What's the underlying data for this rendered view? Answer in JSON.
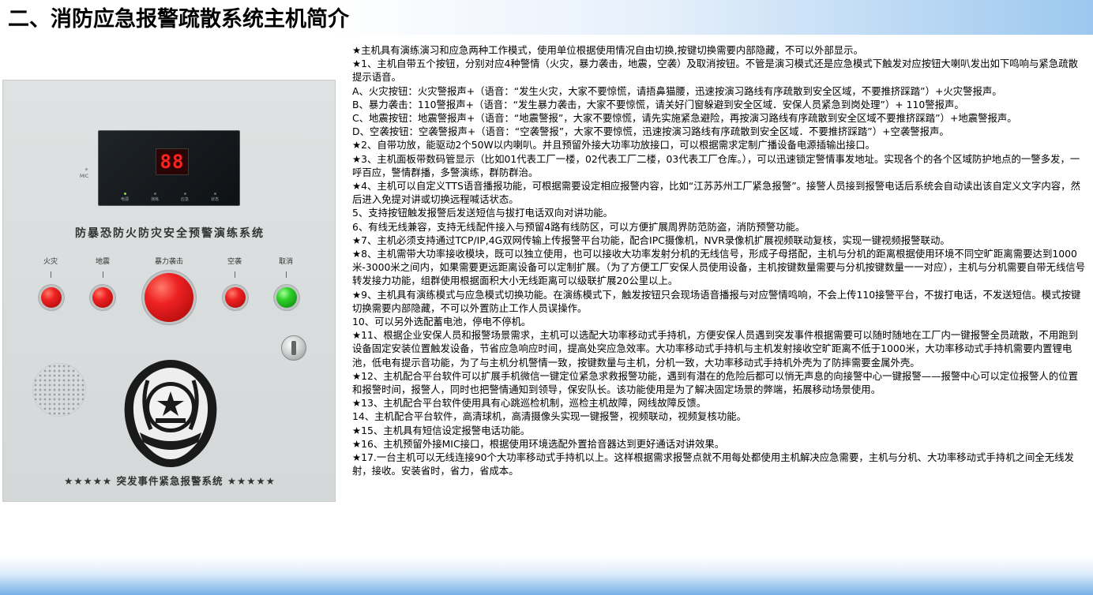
{
  "title": "二、消防应急报警疏散系统主机简介",
  "device": {
    "display_digits": "88",
    "mic_label": "MIC",
    "indicators": [
      "电源",
      "演练",
      "应急",
      "状态"
    ],
    "panel_title": "防暴恐防火防灾安全预警演练系统",
    "buttons": [
      {
        "label": "火灾",
        "color": "red"
      },
      {
        "label": "地震",
        "color": "red"
      },
      {
        "label": "暴力袭击",
        "color": "red"
      },
      {
        "label": "空袭",
        "color": "red"
      },
      {
        "label": "取消",
        "color": "green"
      }
    ],
    "footer": "★★★★★  突发事件紧急报警系统  ★★★★★"
  },
  "paragraphs": [
    "★主机具有演练演习和应急两种工作模式，使用单位根据使用情况自由切换,按键切换需要内部隐藏，不可以外部显示。",
    "★1、主机自带五个按钮，分别对应4种警情（火灾，暴力袭击，地震，空袭）及取消按钮。不管是演习模式还是应急模式下触发对应按钮大喇叭发出如下鸣响与紧急疏散提示语音。",
    "A、火灾按钮：火灾警报声+（语音：“发生火灾，大家不要惊慌，请捂鼻猫腰，迅速按演习路线有序疏散到安全区域，不要推挤踩踏”）+火灾警报声。",
    "B、暴力袭击：110警报声+（语音：“发生暴力袭击，大家不要惊慌，请关好门窗躲避到安全区域．安保人员紧急到岗处理”）+ 110警报声。",
    "C、地震按钮：地震警报声+（语音：“地震警报”，大家不要惊慌，请先实施紧急避险，再按演习路线有序疏散到安全区域不要推挤踩踏”）+地震警报声。",
    "D、空袭按钮：空袭警报声+（语音：“空袭警报”，大家不要惊慌，迅速按演习路线有序疏散到安全区域．不要推挤踩踏”）+空袭警报声。",
    "★2、自带功放，能驱动2个50W以内喇叭。并且预留外接大功率功放接口，可以根据需求定制广播设备电源插输出接口。",
    "★3、主机面板带数码管显示（比如01代表工厂一楼，02代表工厂二楼，03代表工厂仓库。），可以迅速锁定警情事发地址。实现各个的各个区域防护地点的一警多发，一呼百应，警情群播，多警演练，群防群治。",
    "★4、主机可以自定义TTS语音播报功能，可根据需要设定相应报警内容，比如“江苏苏州工厂紧急报警”。接警人员接到报警电话后系统会自动读出该自定义文字内容，然后进入免提对讲或切换远程喊话状态。",
    "5、支持按钮触发报警后发送短信与拔打电话双向对讲功能。",
    "6、有线无线兼容，支持无线配件接入与预留4路有线防区，可以方便扩展周界防范防盗，消防预警功能。",
    "★7、主机必须支持通过TCP/IP,4G双网传输上传报警平台功能，配合IPC摄像机，NVR录像机扩展视频联动复核，实现一键视频报警联动。",
    "★8、主机需带大功率接收模块，既可以独立使用，也可以接收大功率发射分机的无线信号，形成子母搭配，主机与分机的距离根据使用环境不同空旷距离需要达到1000米-3000米之间内，如果需要更远距离设备可以定制扩展。（为了方便工厂安保人员使用设备，主机按键数量需要与分机按键数量一一对应），主机与分机需要自带无线信号转发接力功能，组群使用根据面积大小无线距离可以级联扩展20公里以上。",
    "★9、主机具有演练模式与应急模式切换功能。在演练模式下，触发按钮只会现场语音播报与对应警情鸣响，不会上传110接警平台，不拔打电话，不发送短信。模式按键切换需要内部隐藏，不可以外置防止工作人员误操作。",
    "10、可以另外选配蓄电池，停电不停机。",
    "★11、根据企业安保人员和报警场景需求，主机可以选配大功率移动式手持机，方便安保人员遇到突发事件根据需要可以随时随地在工厂内一键报警全员疏散，不用跑到设备固定安装位置触发设备，节省应急响应时间，提高处突应急效率。大功率移动式手持机与主机发射接收空旷距离不低于1000米，大功率移动式手持机需要内置锂电池，低电有提示音功能，为了与主机分机警情一致，按键数量与主机，分机一致，大功率移动式手持机外壳为了防摔需要金属外壳。",
    "★12、主机配合平台软件可以扩展手机微信一键定位紧急求救报警功能，遇到有潜在的危险后都可以悄无声息的向接警中心一键报警——报警中心可以定位报警人的位置和报警时间，报警人，同时也把警情通知到领导，保安队长。该功能使用是为了解决固定场景的弊端，拓展移动场景使用。",
    "★13、主机配合平台软件使用具有心跳巡检机制，巡检主机故障，网线故障反馈。",
    "14、主机配合平台软件，高清球机，高清摄像头实现一键报警，视频联动，视频复核功能。",
    "★15、主机具有短信设定报警电话功能。",
    "★16、主机预留外接MIC接口，根据使用环境选配外置拾音器达到更好通话对讲效果。",
    "★17.一台主机可以无线连接90个大功率移动式手持机以上。这样根据需求报警点就不用每处都使用主机解决应急需要，主机与分机、大功率移动式手持机之间全无线发射，接收。安装省时，省力，省成本。"
  ]
}
